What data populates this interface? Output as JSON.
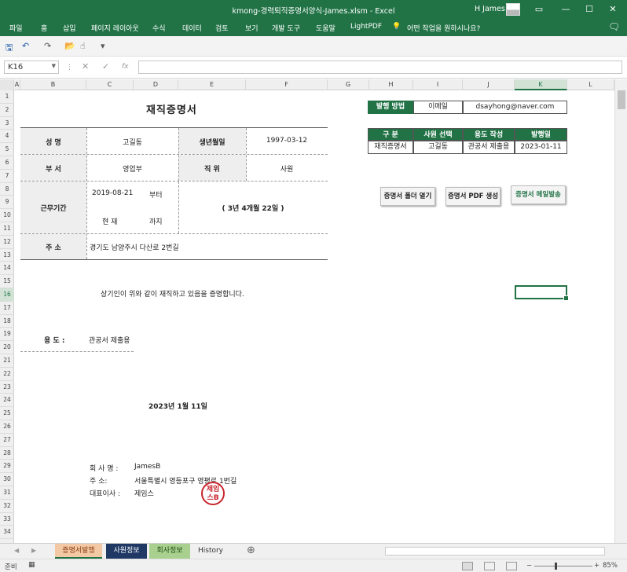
{
  "window": {
    "title": "kmong-경력퇴직증명서양식-James.xlsm  -  Excel",
    "user": "H James",
    "minimize": "—",
    "maximize": "☐",
    "close": "✕",
    "ribbon_collapse": "▭"
  },
  "ribbon": {
    "tabs": [
      "파일",
      "홈",
      "삽입",
      "페이지 레이아웃",
      "수식",
      "데이터",
      "검토",
      "보기",
      "개발 도구",
      "도움말",
      "LightPDF"
    ],
    "tell_me": "어떤 작업을 원하시나요?",
    "share_icon": "comment-icon"
  },
  "quick_access": {
    "save": "🖫",
    "undo": "↶",
    "redo": "↷",
    "folder": "📂",
    "touch": "☝",
    "customize": "▾"
  },
  "formula_bar": {
    "name_box": "K16",
    "cancel": "✕",
    "enter": "✓",
    "fx": "fx",
    "formula": ""
  },
  "columns": [
    "A",
    "B",
    "C",
    "D",
    "E",
    "F",
    "G",
    "H",
    "I",
    "J",
    "K",
    "L"
  ],
  "rows": [
    "1",
    "2",
    "3",
    "4",
    "5",
    "6",
    "7",
    "8",
    "9",
    "10",
    "11",
    "12",
    "13",
    "14",
    "15",
    "16",
    "17",
    "18",
    "19",
    "20",
    "21",
    "22",
    "23",
    "24",
    "25",
    "26",
    "27",
    "28",
    "29",
    "30",
    "31",
    "32",
    "33",
    "34"
  ],
  "certificate": {
    "title": "재직증명서",
    "name_label": "성    명",
    "name_value": "고길동",
    "birth_label": "생년월일",
    "birth_value": "1997-03-12",
    "dept_label": "부    서",
    "dept_value": "영업부",
    "position_label": "직    위",
    "position_value": "사원",
    "period_label": "근무기간",
    "start_date": "2019-08-21",
    "from_word": "부터",
    "now_word": "현  재",
    "until_word": "까지",
    "duration": "( 3년 4개월 22일 )",
    "address_label": "주    소",
    "address_value": "경기도 남양주시 다산로 2번길",
    "statement": "상기인이  위와 같이 재직하고 있음을 증명합니다.",
    "purpose_label": "용  도 :",
    "purpose_value": "관공서 제출용",
    "issue_date": "2023년 1월 11일",
    "company_label": "회 사 명 :",
    "company_value": "JamesB",
    "company_address_label": "주     소:",
    "company_address_value": "서울특별시 영등포구 영평로 1번길",
    "ceo_label": "대표이사 :",
    "ceo_value": "제임스",
    "stamp_text": "제임스B"
  },
  "side_panel": {
    "issue_method_label": "발행 방법",
    "issue_method_value": "이메일",
    "email": "dsayhong@naver.com",
    "headers": [
      "구  분",
      "사원 선택",
      "용도 작성",
      "발행일"
    ],
    "row": [
      "재직증명서",
      "고길동",
      "관공서 제출용",
      "2023-01-11"
    ],
    "buttons": [
      "증명서 폴더 열기",
      "증명서 PDF 생성",
      "증명서 메일발송"
    ]
  },
  "sheet_tabs": {
    "tabs": [
      {
        "label": "증명서발행",
        "bg": "#f2c9a4",
        "color": "#8b3a10"
      },
      {
        "label": "사원정보",
        "bg": "#1f3864",
        "color": "#ffffff"
      },
      {
        "label": "회사정보",
        "bg": "#a9d08e",
        "color": "#1e4d13"
      },
      {
        "label": "History",
        "bg": "#f0f0f0",
        "color": "#333333"
      }
    ],
    "add": "⊕",
    "nav_prev": "◀",
    "nav_next": "▶"
  },
  "status_bar": {
    "ready": "준비",
    "zoom": "85%",
    "zoom_minus": "−",
    "zoom_plus": "+"
  },
  "colors": {
    "excel_green": "#217346",
    "stamp_red": "#c8252c"
  }
}
